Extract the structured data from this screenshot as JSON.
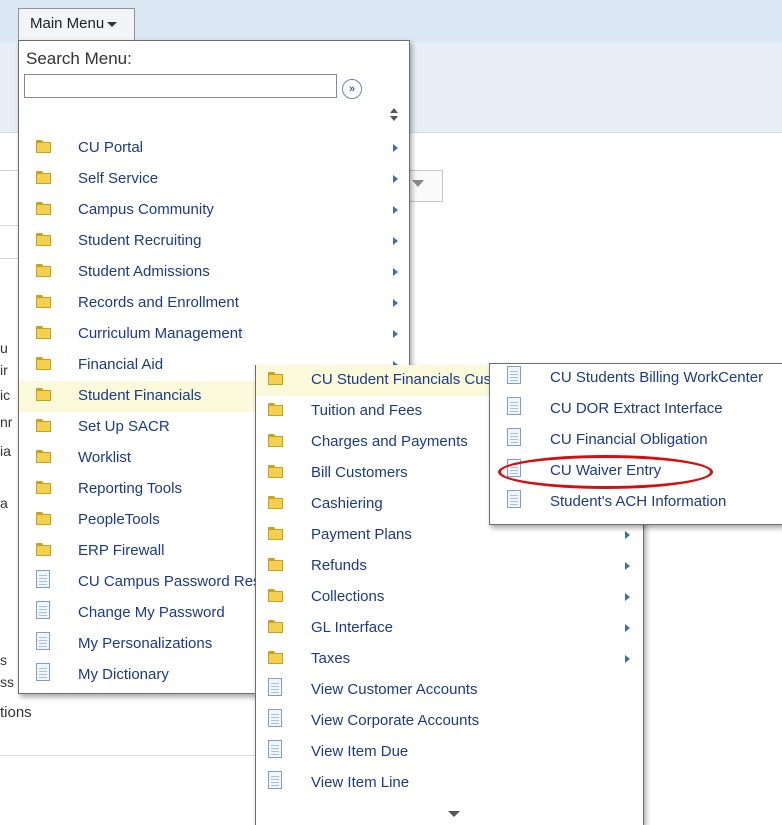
{
  "main_menu": {
    "button_label": "Main Menu",
    "search_label": "Search Menu:",
    "search_value": "",
    "go_glyph": "»",
    "items": [
      {
        "label": "CU Portal",
        "icon": "folder-icon",
        "submenu": true
      },
      {
        "label": "Self Service",
        "icon": "folder-icon",
        "submenu": true
      },
      {
        "label": "Campus Community",
        "icon": "folder-icon",
        "submenu": true
      },
      {
        "label": "Student Recruiting",
        "icon": "folder-icon",
        "submenu": true
      },
      {
        "label": "Student Admissions",
        "icon": "folder-icon",
        "submenu": true
      },
      {
        "label": "Records and Enrollment",
        "icon": "folder-icon",
        "submenu": true
      },
      {
        "label": "Curriculum Management",
        "icon": "folder-icon",
        "submenu": true
      },
      {
        "label": "Financial Aid",
        "icon": "folder-icon",
        "submenu": true
      },
      {
        "label": "Student Financials",
        "icon": "folder-icon",
        "submenu": true,
        "highlighted": true
      },
      {
        "label": "Set Up SACR",
        "icon": "folder-icon",
        "submenu": true
      },
      {
        "label": "Worklist",
        "icon": "folder-icon",
        "submenu": true
      },
      {
        "label": "Reporting Tools",
        "icon": "folder-icon",
        "submenu": true
      },
      {
        "label": "PeopleTools",
        "icon": "folder-icon",
        "submenu": true
      },
      {
        "label": "ERP Firewall",
        "icon": "folder-icon",
        "submenu": true
      },
      {
        "label": "CU Campus Password Reset",
        "icon": "page-icon",
        "submenu": false
      },
      {
        "label": "Change My Password",
        "icon": "page-icon",
        "submenu": false
      },
      {
        "label": "My Personalizations",
        "icon": "page-icon",
        "submenu": false
      },
      {
        "label": "My Dictionary",
        "icon": "page-icon",
        "submenu": false
      }
    ]
  },
  "student_financials_menu": {
    "items": [
      {
        "label": "CU Student Financials Custom",
        "icon": "folder-icon",
        "submenu": true,
        "highlighted": true
      },
      {
        "label": "Tuition and Fees",
        "icon": "folder-icon",
        "submenu": true
      },
      {
        "label": "Charges and Payments",
        "icon": "folder-icon",
        "submenu": true
      },
      {
        "label": "Bill Customers",
        "icon": "folder-icon",
        "submenu": true
      },
      {
        "label": "Cashiering",
        "icon": "folder-icon",
        "submenu": true
      },
      {
        "label": "Payment Plans",
        "icon": "folder-icon",
        "submenu": true
      },
      {
        "label": "Refunds",
        "icon": "folder-icon",
        "submenu": true
      },
      {
        "label": "Collections",
        "icon": "folder-icon",
        "submenu": true
      },
      {
        "label": "GL Interface",
        "icon": "folder-icon",
        "submenu": true
      },
      {
        "label": "Taxes",
        "icon": "folder-icon",
        "submenu": true
      },
      {
        "label": "View Customer Accounts",
        "icon": "page-icon",
        "submenu": false
      },
      {
        "label": "View Corporate Accounts",
        "icon": "page-icon",
        "submenu": false
      },
      {
        "label": "View Item Due",
        "icon": "page-icon",
        "submenu": false
      },
      {
        "label": "View Item Line",
        "icon": "page-icon",
        "submenu": false
      }
    ]
  },
  "cu_custom_menu": {
    "items": [
      {
        "label": "CU Students Billing WorkCenter",
        "icon": "page-icon"
      },
      {
        "label": "CU DOR Extract Interface",
        "icon": "page-icon"
      },
      {
        "label": "CU Financial Obligation",
        "icon": "page-icon"
      },
      {
        "label": "CU Waiver Entry",
        "icon": "page-icon",
        "circled": true
      },
      {
        "label": "Student's ACH Information",
        "icon": "page-icon"
      }
    ]
  },
  "background": {
    "fragments": [
      "u",
      "ir",
      "ic",
      "nr",
      "ia",
      "a",
      "s",
      "ss"
    ],
    "tions_text": "tions"
  },
  "colors": {
    "link": "#1a3a8a",
    "highlight": "#fafadb",
    "annotation_circle": "#d50f0f",
    "folder": "#f3d04f"
  }
}
